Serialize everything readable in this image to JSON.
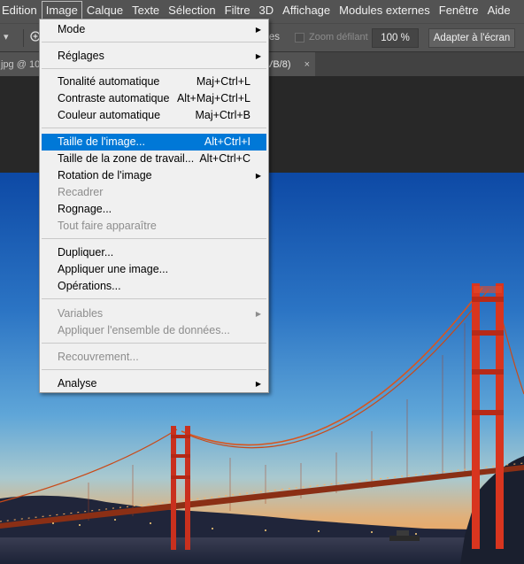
{
  "menubar": {
    "items": [
      "Edition",
      "Image",
      "Calque",
      "Texte",
      "Sélection",
      "Filtre",
      "3D",
      "Affichage",
      "Modules externes",
      "Fenêtre",
      "Aide"
    ],
    "active": "Image"
  },
  "options": {
    "resize_windows_fragment": "res",
    "scroll_all_label": "Zoom défilant",
    "zoom_value": "100 %",
    "fit_screen_label": "Adapter à l'écran"
  },
  "tabs": {
    "tab1_label": "jpg @ 10",
    "tab2_label": "VB/8)",
    "close_glyph": "×"
  },
  "image_menu": {
    "mode": "Mode",
    "adjustments": "Réglages",
    "auto_tone": {
      "label": "Tonalité automatique",
      "shortcut": "Maj+Ctrl+L"
    },
    "auto_contrast": {
      "label": "Contraste automatique",
      "shortcut": "Alt+Maj+Ctrl+L"
    },
    "auto_color": {
      "label": "Couleur automatique",
      "shortcut": "Maj+Ctrl+B"
    },
    "image_size": {
      "label": "Taille de l'image...",
      "shortcut": "Alt+Ctrl+I"
    },
    "canvas_size": {
      "label": "Taille de la zone de travail...",
      "shortcut": "Alt+Ctrl+C"
    },
    "rotation": "Rotation de l'image",
    "crop": "Recadrer",
    "trim": "Rognage...",
    "reveal_all": "Tout faire apparaître",
    "duplicate": "Dupliquer...",
    "apply_image": "Appliquer une image...",
    "calculations": "Opérations...",
    "variables": "Variables",
    "apply_data_set": "Appliquer l'ensemble de données...",
    "trap": "Recouvrement...",
    "analysis": "Analyse"
  },
  "colors": {
    "highlight": "#0078d7",
    "menu_bg": "#f0f0f0",
    "ui_bg": "#535353"
  }
}
